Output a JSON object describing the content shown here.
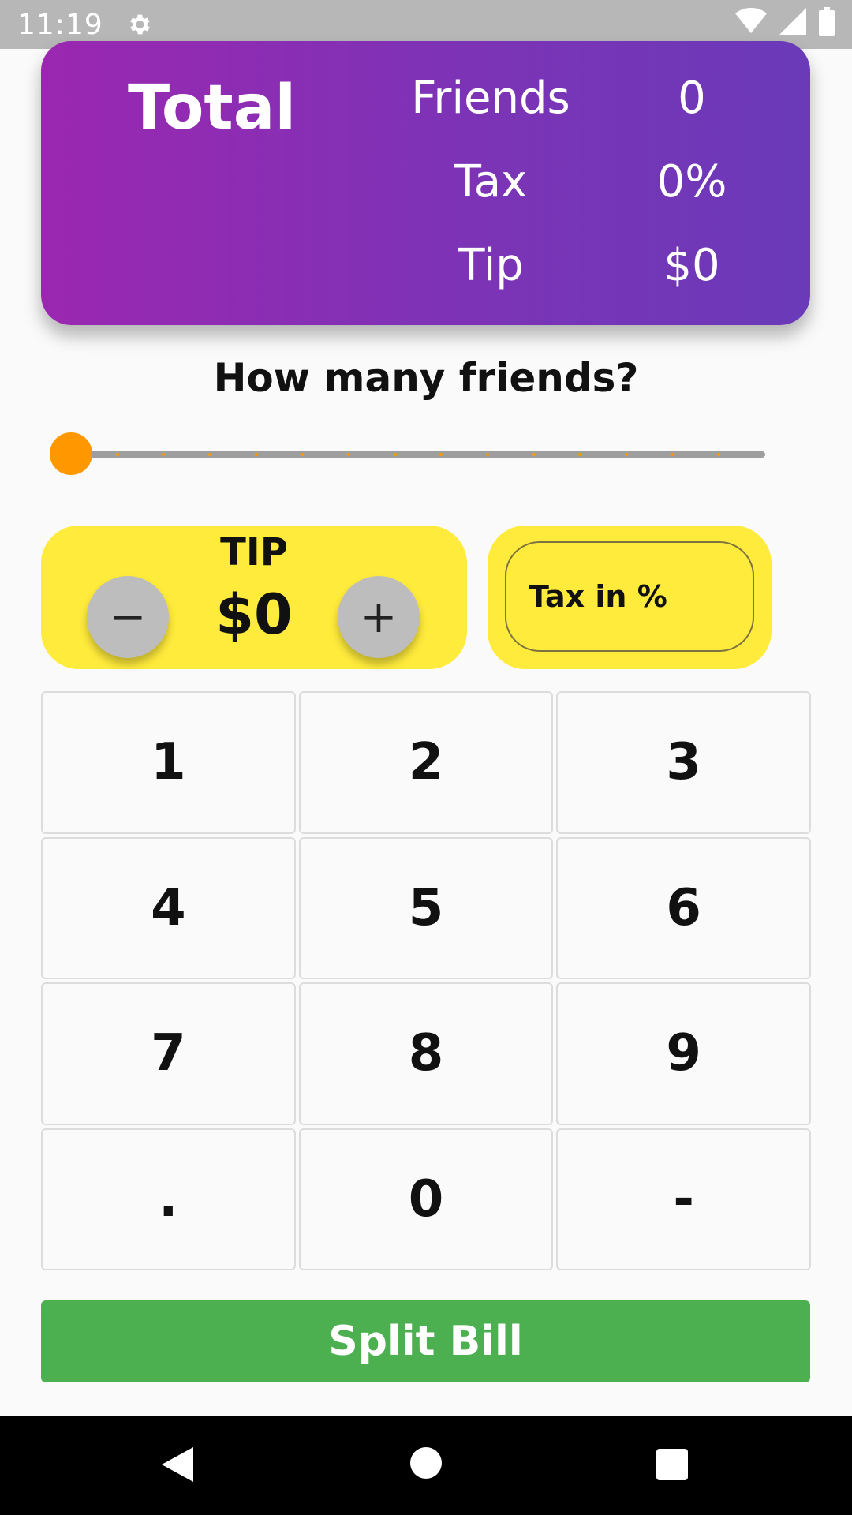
{
  "status_bar": {
    "time": "11:19",
    "icons": [
      "gear-icon",
      "wifi-icon",
      "signal-icon",
      "battery-icon"
    ]
  },
  "summary": {
    "title": "Total",
    "friends_label": "Friends",
    "friends_value": "0",
    "tax_label": "Tax",
    "tax_value": "0%",
    "tip_label": "Tip",
    "tip_value": "$0",
    "gradient_colors": [
      "#9b27b0",
      "#6a3ab8"
    ]
  },
  "friends_question": "How many friends?",
  "slider": {
    "value": 0,
    "min": 0,
    "max": 15,
    "accent": "#ff9800"
  },
  "tip": {
    "label": "TIP",
    "value": "$0",
    "minus_label": "−",
    "plus_label": "+"
  },
  "tax": {
    "placeholder": "Tax in %"
  },
  "keypad": {
    "keys": [
      "1",
      "2",
      "3",
      "4",
      "5",
      "6",
      "7",
      "8",
      "9",
      ".",
      "0",
      "-"
    ]
  },
  "split_button": {
    "label": "Split Bill",
    "color": "#4caf50"
  },
  "nav": {
    "icons": [
      "back-icon",
      "home-icon",
      "recents-icon"
    ]
  }
}
